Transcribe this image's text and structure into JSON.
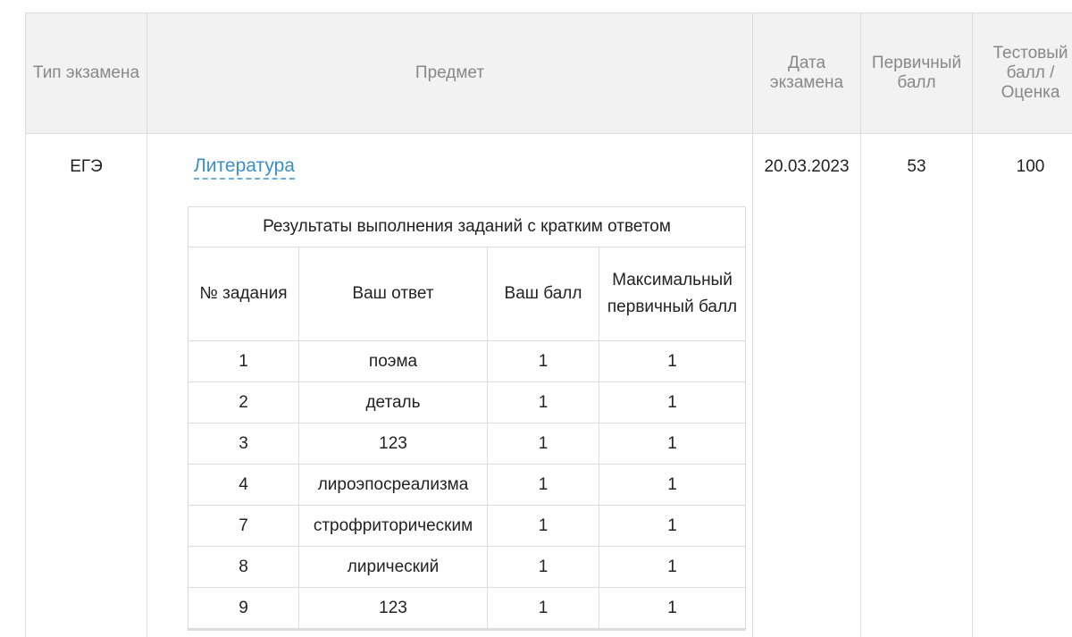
{
  "columns": {
    "type": "Тип экзамена",
    "subject": "Предмет",
    "date": "Дата экзамена",
    "primary": "Первичный балл",
    "score": "Тестовый балл / Оценка"
  },
  "exam": {
    "type": "ЕГЭ",
    "subject": "Литература",
    "date": "20.03.2023",
    "primary_score": "53",
    "test_score": "100"
  },
  "short_answers": {
    "caption": "Результаты выполнения заданий с кратким ответом",
    "headers": {
      "task_no": "№ задания",
      "answer": "Ваш ответ",
      "score": "Ваш балл",
      "max": "Максимальный первичный балл"
    },
    "rows": [
      {
        "task": "1",
        "answer": "поэма",
        "score": "1",
        "max": "1"
      },
      {
        "task": "2",
        "answer": "деталь",
        "score": "1",
        "max": "1"
      },
      {
        "task": "3",
        "answer": "123",
        "score": "1",
        "max": "1"
      },
      {
        "task": "4",
        "answer": "лироэпосреализма",
        "score": "1",
        "max": "1"
      },
      {
        "task": "7",
        "answer": "строфриторическим",
        "score": "1",
        "max": "1"
      },
      {
        "task": "8",
        "answer": "лирический",
        "score": "1",
        "max": "1"
      },
      {
        "task": "9",
        "answer": "123",
        "score": "1",
        "max": "1"
      }
    ]
  }
}
